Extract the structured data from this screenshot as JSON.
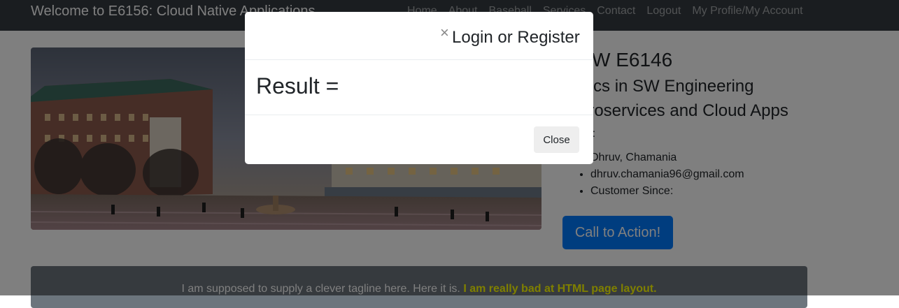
{
  "navbar": {
    "brand": "Welcome to E6156: Cloud Native Applications",
    "links": [
      "Home",
      "About",
      "Baseball",
      "Services",
      "Contact",
      "Logout",
      "My Profile/My Account"
    ]
  },
  "course": {
    "title": "MSW E6146",
    "subtitle1": "Topics in SW Engineering",
    "subtitle2": "Microservices and Cloud Apps",
    "name_label": "Name:",
    "details": [
      "Dhruv, Chamania",
      "dhruv.chamania96@gmail.com",
      "Customer Since:"
    ],
    "cta_label": "Call to Action!"
  },
  "tagline": {
    "text": "I am supposed to supply a clever tagline here. Here it is.",
    "highlight": "I am really bad at HTML page layout."
  },
  "modal": {
    "title": "Login or Register",
    "close_icon": "×",
    "result_label": "Result =",
    "close_button": "Close"
  },
  "colors": {
    "navbar": "#343a40",
    "primary": "#007bff",
    "tagline_bg": "#6c757d",
    "highlight": "#ffff00"
  }
}
